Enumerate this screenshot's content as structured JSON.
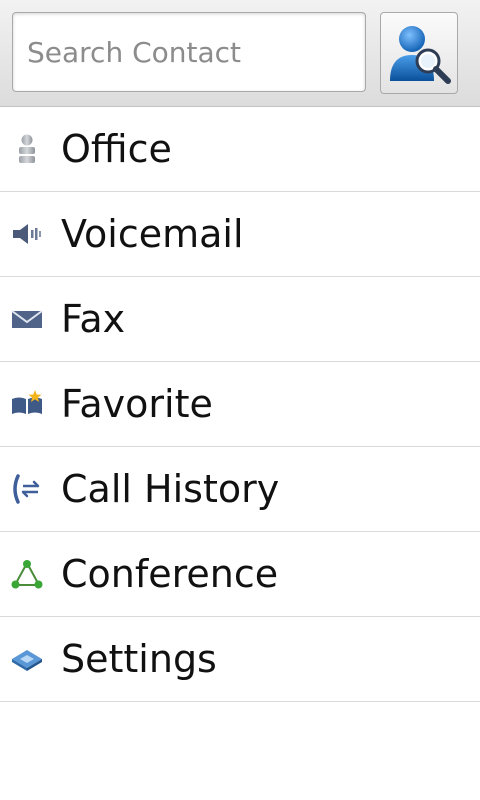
{
  "search": {
    "placeholder": "Search Contact",
    "value": "",
    "button_icon": "contact-search-icon"
  },
  "menu": {
    "items": [
      {
        "label": "Office",
        "icon": "person-icon"
      },
      {
        "label": "Voicemail",
        "icon": "speaker-icon"
      },
      {
        "label": "Fax",
        "icon": "envelope-icon"
      },
      {
        "label": "Favorite",
        "icon": "book-star-icon"
      },
      {
        "label": "Call History",
        "icon": "call-history-icon"
      },
      {
        "label": "Conference",
        "icon": "conference-icon"
      },
      {
        "label": "Settings",
        "icon": "settings-icon"
      }
    ]
  },
  "colors": {
    "accent_blue": "#1f6fc0",
    "conference_green": "#3aa635",
    "divider": "#d9d9d9"
  }
}
